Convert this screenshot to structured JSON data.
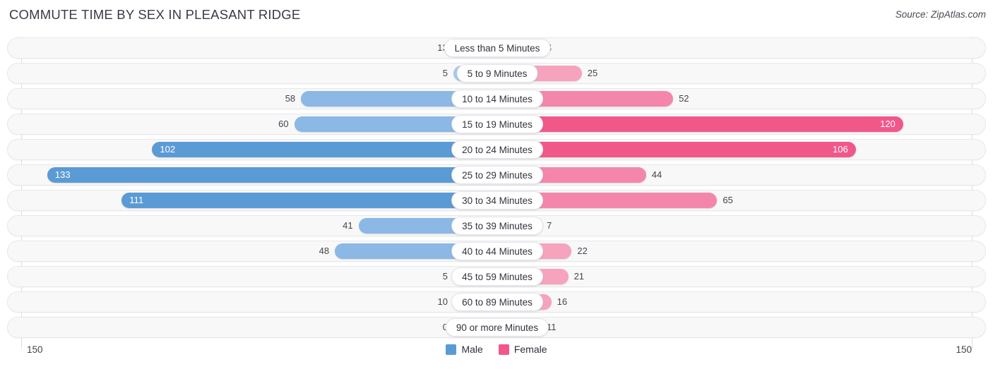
{
  "header": {
    "title": "COMMUTE TIME BY SEX IN PLEASANT RIDGE",
    "source": "Source: ZipAtlas.com"
  },
  "axis": {
    "left_end_label": "150",
    "right_end_label": "150",
    "max": 150
  },
  "legend": {
    "items": [
      {
        "label": "Male",
        "color": "#5B9BD5"
      },
      {
        "label": "Female",
        "color": "#F1588A"
      }
    ]
  },
  "colors": {
    "male_light": "#A8C8EC",
    "male_mid": "#8BB8E4",
    "male_dark": "#5B9BD5",
    "female_light": "#F6A3BE",
    "female_mid": "#F486AC",
    "female_dark": "#F1588A",
    "track_bg": "#F8F8F9",
    "track_border": "#E8E8EC",
    "axis_line": "#DCDCE2",
    "text": "#44444E"
  },
  "chart_data": {
    "type": "bar",
    "subtype": "diverging-bidirectional",
    "title": "COMMUTE TIME BY SEX IN PLEASANT RIDGE",
    "xlabel": "",
    "ylabel": "",
    "xlim": [
      150,
      150
    ],
    "grid": false,
    "legend_position": "bottom-center",
    "categories": [
      "Less than 5 Minutes",
      "5 to 9 Minutes",
      "10 to 14 Minutes",
      "15 to 19 Minutes",
      "20 to 24 Minutes",
      "25 to 29 Minutes",
      "30 to 34 Minutes",
      "35 to 39 Minutes",
      "40 to 44 Minutes",
      "45 to 59 Minutes",
      "60 to 89 Minutes",
      "90 or more Minutes"
    ],
    "series": [
      {
        "name": "Male",
        "direction": "left",
        "color": "#5B9BD5",
        "values": [
          13,
          5,
          58,
          60,
          102,
          133,
          111,
          41,
          48,
          5,
          10,
          0
        ]
      },
      {
        "name": "Female",
        "direction": "right",
        "color": "#F1588A",
        "values": [
          4,
          25,
          52,
          120,
          106,
          44,
          65,
          7,
          22,
          21,
          16,
          11
        ]
      }
    ]
  }
}
